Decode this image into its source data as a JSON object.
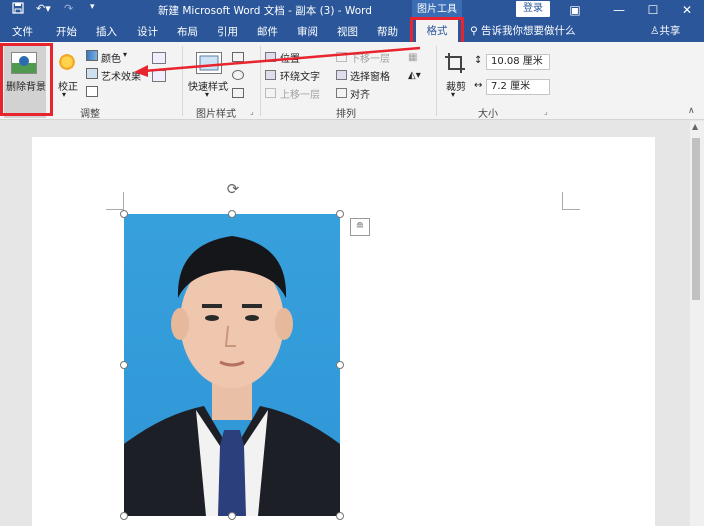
{
  "titlebar": {
    "doc_title": "新建 Microsoft Word 文档 - 副本 (3)  -  Word",
    "context_group": "图片工具",
    "login": "登录",
    "window_buttons": [
      "restore-icon",
      "minimize-icon",
      "maximize-icon",
      "close-icon"
    ]
  },
  "tabs": {
    "items": [
      "文件",
      "开始",
      "插入",
      "设计",
      "布局",
      "引用",
      "邮件",
      "审阅",
      "视图",
      "帮助"
    ],
    "active": "格式",
    "tell_me": "告诉我你想要做什么",
    "share": "共享"
  },
  "ribbon": {
    "adjust": {
      "remove_bg": "删除背景",
      "correct": "校正",
      "color": "颜色",
      "artistic": "艺术效果",
      "label": "调整"
    },
    "style": {
      "quick_styles": "快速样式",
      "label": "图片样式"
    },
    "arrange": {
      "position": "位置",
      "wrap_text": "环绕文字",
      "bring_forward": "上移一层",
      "send_backward": "下移一层",
      "selection_pane": "选择窗格",
      "align": "对齐",
      "label": "排列"
    },
    "size": {
      "crop": "裁剪",
      "height": "10.08 厘米",
      "width": "7.2 厘米",
      "label": "大小"
    }
  },
  "colors": {
    "brand": "#2b579a",
    "highlight": "#e8242e",
    "photo_bg": "#2f96d6"
  }
}
